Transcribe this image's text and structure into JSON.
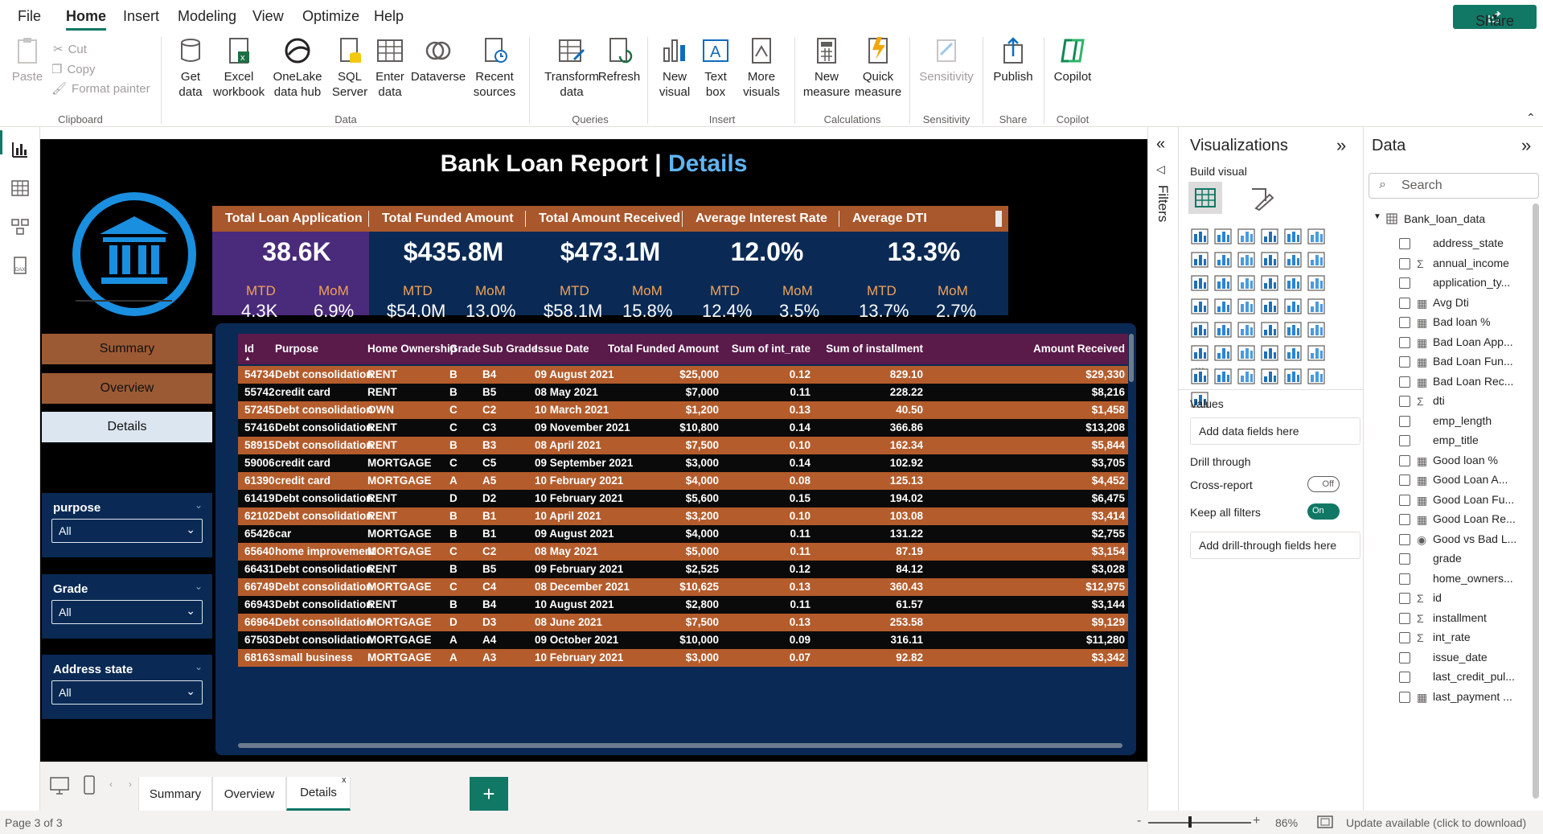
{
  "menu": {
    "tabs": [
      "File",
      "Home",
      "Insert",
      "Modeling",
      "View",
      "Optimize",
      "Help"
    ],
    "share": "Share"
  },
  "ribbon": {
    "clipboard": {
      "paste": "Paste",
      "cut": "Cut",
      "copy": "Copy",
      "format_painter": "Format painter",
      "group": "Clipboard"
    },
    "data": {
      "get_data": "Get\ndata",
      "excel": "Excel\nworkbook",
      "onelake": "OneLake\ndata hub",
      "sql": "SQL\nServer",
      "enter": "Enter\ndata",
      "dataverse": "Dataverse",
      "recent": "Recent\nsources",
      "group": "Data"
    },
    "queries": {
      "transform": "Transform\ndata",
      "refresh": "Refresh",
      "group": "Queries"
    },
    "insert": {
      "new_visual": "New\nvisual",
      "text_box": "Text\nbox",
      "more_visuals": "More\nvisuals",
      "group": "Insert"
    },
    "calc": {
      "new_measure": "New\nmeasure",
      "quick_measure": "Quick\nmeasure",
      "group": "Calculations"
    },
    "sensitivity": {
      "label": "Sensitivity",
      "group": "Sensitivity"
    },
    "share": {
      "publish": "Publish",
      "group": "Share"
    },
    "copilot": {
      "label": "Copilot",
      "group": "Copilot"
    }
  },
  "report": {
    "title_main": "Bank Loan Report | ",
    "title_highlight": "Details",
    "nav": [
      "Summary",
      "Overview",
      "Details"
    ],
    "slicers": [
      {
        "label": "purpose",
        "value": "All"
      },
      {
        "label": "Grade",
        "value": "All"
      },
      {
        "label": "Address state",
        "value": "All"
      }
    ],
    "kpis": [
      {
        "title": "Total Loan Application",
        "value": "38.6K",
        "mtd_label": "MTD",
        "mom_label": "MoM",
        "mtd": "4.3K",
        "mom": "6.9%"
      },
      {
        "title": "Total Funded Amount",
        "value": "$435.8M",
        "mtd_label": "MTD",
        "mom_label": "MoM",
        "mtd": "$54.0M",
        "mom": "13.0%"
      },
      {
        "title": "Total Amount Received",
        "value": "$473.1M",
        "mtd_label": "MTD",
        "mom_label": "MoM",
        "mtd": "$58.1M",
        "mom": "15.8%"
      },
      {
        "title": "Average Interest Rate",
        "value": "12.0%",
        "mtd_label": "MTD",
        "mom_label": "MoM",
        "mtd": "12.4%",
        "mom": "3.5%"
      },
      {
        "title": "Average DTI",
        "value": "13.3%",
        "mtd_label": "MTD",
        "mom_label": "MoM",
        "mtd": "13.7%",
        "mom": "2.7%"
      }
    ],
    "table": {
      "headers": [
        "Id",
        "Purpose",
        "Home Ownership",
        "Grade",
        "Sub Grade",
        "Issue Date",
        "Total Funded Amount",
        "Sum of int_rate",
        "Sum of installment",
        "Amount Received"
      ],
      "rows": [
        [
          "54734",
          "Debt consolidation",
          "RENT",
          "B",
          "B4",
          "09 August 2021",
          "$25,000",
          "0.12",
          "829.10",
          "$29,330"
        ],
        [
          "55742",
          "credit card",
          "RENT",
          "B",
          "B5",
          "08 May 2021",
          "$7,000",
          "0.11",
          "228.22",
          "$8,216"
        ],
        [
          "57245",
          "Debt consolidation",
          "OWN",
          "C",
          "C2",
          "10 March 2021",
          "$1,200",
          "0.13",
          "40.50",
          "$1,458"
        ],
        [
          "57416",
          "Debt consolidation",
          "RENT",
          "C",
          "C3",
          "09 November 2021",
          "$10,800",
          "0.14",
          "366.86",
          "$13,208"
        ],
        [
          "58915",
          "Debt consolidation",
          "RENT",
          "B",
          "B3",
          "08 April 2021",
          "$7,500",
          "0.10",
          "162.34",
          "$5,844"
        ],
        [
          "59006",
          "credit card",
          "MORTGAGE",
          "C",
          "C5",
          "09 September 2021",
          "$3,000",
          "0.14",
          "102.92",
          "$3,705"
        ],
        [
          "61390",
          "credit card",
          "MORTGAGE",
          "A",
          "A5",
          "10 February 2021",
          "$4,000",
          "0.08",
          "125.13",
          "$4,452"
        ],
        [
          "61419",
          "Debt consolidation",
          "RENT",
          "D",
          "D2",
          "10 February 2021",
          "$5,600",
          "0.15",
          "194.02",
          "$6,475"
        ],
        [
          "62102",
          "Debt consolidation",
          "RENT",
          "B",
          "B1",
          "10 April 2021",
          "$3,200",
          "0.10",
          "103.08",
          "$3,414"
        ],
        [
          "65426",
          "car",
          "MORTGAGE",
          "B",
          "B1",
          "09 August 2021",
          "$4,000",
          "0.11",
          "131.22",
          "$2,755"
        ],
        [
          "65640",
          "home improvement",
          "MORTGAGE",
          "C",
          "C2",
          "08 May 2021",
          "$5,000",
          "0.11",
          "87.19",
          "$3,154"
        ],
        [
          "66431",
          "Debt consolidation",
          "RENT",
          "B",
          "B5",
          "09 February 2021",
          "$2,525",
          "0.12",
          "84.12",
          "$3,028"
        ],
        [
          "66749",
          "Debt consolidation",
          "MORTGAGE",
          "C",
          "C4",
          "08 December 2021",
          "$10,625",
          "0.13",
          "360.43",
          "$12,975"
        ],
        [
          "66943",
          "Debt consolidation",
          "RENT",
          "B",
          "B4",
          "10 August 2021",
          "$2,800",
          "0.11",
          "61.57",
          "$3,144"
        ],
        [
          "66964",
          "Debt consolidation",
          "MORTGAGE",
          "D",
          "D3",
          "08 June 2021",
          "$7,500",
          "0.13",
          "253.58",
          "$9,129"
        ],
        [
          "67503",
          "Debt consolidation",
          "MORTGAGE",
          "A",
          "A4",
          "09 October 2021",
          "$10,000",
          "0.09",
          "316.11",
          "$11,280"
        ],
        [
          "68163",
          "small business",
          "MORTGAGE",
          "A",
          "A3",
          "10 February 2021",
          "$3,000",
          "0.07",
          "92.82",
          "$3,342"
        ]
      ]
    }
  },
  "pages": {
    "tabs": [
      "Summary",
      "Overview",
      "Details"
    ],
    "selected": "Details",
    "add": "+",
    "close": "x"
  },
  "status": {
    "page": "Page 3 of 3",
    "zoom": "86%",
    "update": "Update available (click to download)",
    "minus": "-",
    "plus": "+"
  },
  "filters": {
    "label": "Filters"
  },
  "visualizations": {
    "title": "Visualizations",
    "build": "Build visual",
    "values_label": "Values",
    "values_placeholder": "Add data fields here",
    "drill": "Drill through",
    "cross_report": "Cross-report",
    "cross_state": "Off",
    "keep_filters": "Keep all filters",
    "keep_state": "On",
    "drill_placeholder": "Add drill-through fields here",
    "more": "..."
  },
  "data_pane": {
    "title": "Data",
    "search": "Search",
    "table": "Bank_loan_data",
    "fields": [
      {
        "icon": "",
        "name": "address_state"
      },
      {
        "icon": "Σ",
        "name": "annual_income"
      },
      {
        "icon": "",
        "name": "application_ty..."
      },
      {
        "icon": "▦",
        "name": "Avg Dti"
      },
      {
        "icon": "▦",
        "name": "Bad loan %"
      },
      {
        "icon": "▦",
        "name": "Bad Loan App..."
      },
      {
        "icon": "▦",
        "name": "Bad Loan Fun..."
      },
      {
        "icon": "▦",
        "name": "Bad Loan Rec..."
      },
      {
        "icon": "Σ",
        "name": "dti"
      },
      {
        "icon": "",
        "name": "emp_length"
      },
      {
        "icon": "",
        "name": "emp_title"
      },
      {
        "icon": "▦",
        "name": "Good loan %"
      },
      {
        "icon": "▦",
        "name": "Good Loan A..."
      },
      {
        "icon": "▦",
        "name": "Good Loan Fu..."
      },
      {
        "icon": "▦",
        "name": "Good Loan Re..."
      },
      {
        "icon": "◉",
        "name": "Good vs Bad L..."
      },
      {
        "icon": "",
        "name": "grade"
      },
      {
        "icon": "",
        "name": "home_owners..."
      },
      {
        "icon": "Σ",
        "name": "id"
      },
      {
        "icon": "Σ",
        "name": "installment"
      },
      {
        "icon": "Σ",
        "name": "int_rate"
      },
      {
        "icon": "",
        "name": "issue_date"
      },
      {
        "icon": "",
        "name": "last_credit_pul..."
      },
      {
        "icon": "▦",
        "name": "last_payment ..."
      }
    ]
  }
}
